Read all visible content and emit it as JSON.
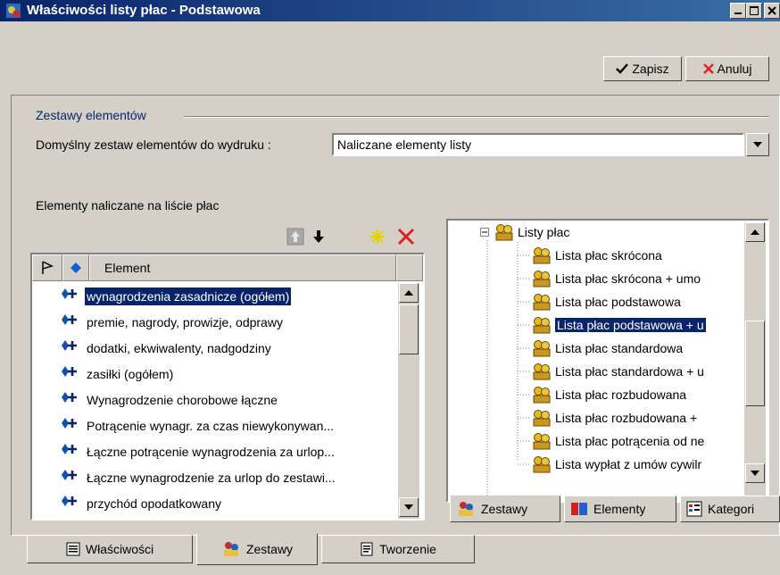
{
  "window": {
    "title": "Właściwości listy płac - Podstawowa",
    "controls": [
      "minimize",
      "maximize",
      "close"
    ]
  },
  "toolbar": {
    "save_label": "Zapisz",
    "cancel_label": "Anuluj"
  },
  "group": {
    "title": "Zestawy elementów",
    "default_set_label": "Domyślny zestaw elementów do wydruku :",
    "default_set_value": "Naliczane elementy listy",
    "elements_label": "Elementy naliczane na liście płac"
  },
  "elements_list": {
    "header_element": "Element",
    "rows": [
      {
        "label": "wynagrodzenia zasadnicze (ogółem)",
        "selected": true
      },
      {
        "label": "premie, nagrody, prowizje, odprawy",
        "selected": false
      },
      {
        "label": "dodatki, ekwiwalenty, nadgodziny",
        "selected": false
      },
      {
        "label": "zasiłki (ogółem)",
        "selected": false
      },
      {
        "label": "Wynagrodzenie chorobowe łączne",
        "selected": false
      },
      {
        "label": "Potrącenie wynagr. za czas niewykonywan...",
        "selected": false
      },
      {
        "label": "Łączne potrącenie wynagrodzenia za urlop...",
        "selected": false
      },
      {
        "label": "Łączne wynagrodzenie za urlop do zestawi...",
        "selected": false
      },
      {
        "label": "przychód opodatkowany",
        "selected": false
      }
    ]
  },
  "tree": {
    "root_label": "Listy płac",
    "items": [
      {
        "label": "Lista płac skrócona",
        "selected": false
      },
      {
        "label": "Lista płac skrócona + umo",
        "selected": false
      },
      {
        "label": "Lista płac podstawowa",
        "selected": false
      },
      {
        "label": "Lista płac podstawowa + u",
        "selected": true
      },
      {
        "label": "Lista płac standardowa",
        "selected": false
      },
      {
        "label": "Lista płac standardowa + u",
        "selected": false
      },
      {
        "label": "Lista płac rozbudowana",
        "selected": false
      },
      {
        "label": "Lista płac rozbudowana +",
        "selected": false
      },
      {
        "label": "Lista płac potrącenia od ne",
        "selected": false
      },
      {
        "label": "Lista wypłat z umów cywilr",
        "selected": false
      }
    ]
  },
  "right_tabs": [
    "Zestawy",
    "Elementy",
    "Kategori"
  ],
  "bottom_tabs": [
    "Właściwości",
    "Zestawy",
    "Tworzenie"
  ],
  "colors": {
    "selection": "#0a246a",
    "face": "#d4d0c8",
    "title_gradient_start": "#0a246a",
    "title_gradient_end": "#3a6ea5"
  }
}
